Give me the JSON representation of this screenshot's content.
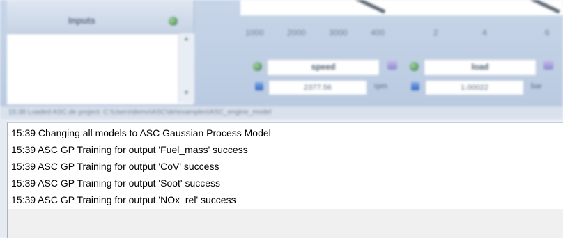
{
  "inputs_panel": {
    "title": "Inputs"
  },
  "graph_ticks": [
    "1000",
    "2000",
    "3000",
    "400",
    "2",
    "4",
    "6"
  ],
  "variables": [
    {
      "name": "speed",
      "value": "2377.56",
      "unit": "rpm"
    },
    {
      "name": "load",
      "value": "1.00022",
      "unit": "bar"
    }
  ],
  "path_bar": {
    "text": "15:38 Loaded ASC.de project: C:\\Users\\demo\\ASC\\de\\examples\\ASC_engine_model"
  },
  "log": {
    "lines": [
      "15:39 Changing all models to ASC Gaussian Process Model",
      "15:39 ASC GP Training for output 'Fuel_mass' success",
      "15:39 ASC GP Training for output 'CoV' success",
      "15:39 ASC GP Training for output 'Soot' success",
      "15:39 ASC GP Training for output 'NOx_rel' success"
    ]
  },
  "colors": {
    "panel_bg": "#c7d5e8",
    "log_bg": "#ffffff",
    "status_bg": "#f0f0f0"
  }
}
